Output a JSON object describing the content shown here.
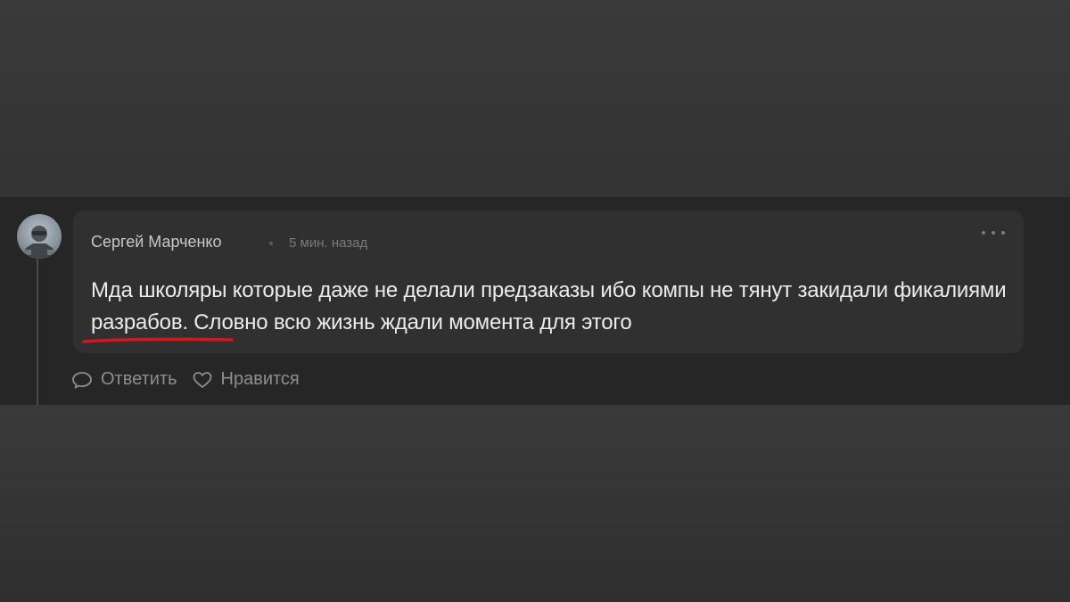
{
  "comment": {
    "author": "Сергей Марченко",
    "time": "5 мин. назад",
    "text": "Мда школяры которые даже не делали предзаказы ибо компы не тянут закидали фикалиями разрабов. Словно всю жизнь ждали момента для этого",
    "highlight_color": "#d9151c",
    "more_icon": "ellipsis-icon"
  },
  "actions": {
    "reply_label": "Ответить",
    "reply_icon": "speech-bubble-icon",
    "like_label": "Нравится",
    "like_icon": "heart-icon"
  }
}
